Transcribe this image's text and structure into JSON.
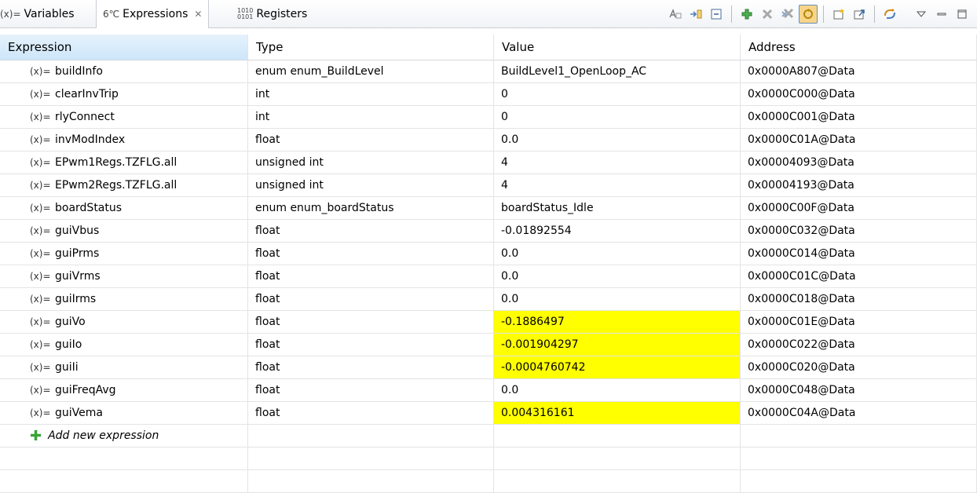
{
  "tabs": [
    {
      "icon": "(x)=",
      "label": "Variables"
    },
    {
      "icon": "6℃",
      "label": "Expressions",
      "close": "✕"
    },
    {
      "icon": "1010\n0101",
      "label": "Registers"
    }
  ],
  "columns": [
    "Expression",
    "Type",
    "Value",
    "Address"
  ],
  "rows": [
    {
      "expr": "buildInfo",
      "type": "enum enum_BuildLevel",
      "value": "BuildLevel1_OpenLoop_AC",
      "address": "0x0000A807@Data",
      "changed": false
    },
    {
      "expr": "clearInvTrip",
      "type": "int",
      "value": "0",
      "address": "0x0000C000@Data",
      "changed": false
    },
    {
      "expr": "rlyConnect",
      "type": "int",
      "value": "0",
      "address": "0x0000C001@Data",
      "changed": false
    },
    {
      "expr": "invModIndex",
      "type": "float",
      "value": "0.0",
      "address": "0x0000C01A@Data",
      "changed": false
    },
    {
      "expr": "EPwm1Regs.TZFLG.all",
      "type": "unsigned int",
      "value": "4",
      "address": "0x00004093@Data",
      "changed": false
    },
    {
      "expr": "EPwm2Regs.TZFLG.all",
      "type": "unsigned int",
      "value": "4",
      "address": "0x00004193@Data",
      "changed": false
    },
    {
      "expr": "boardStatus",
      "type": "enum enum_boardStatus",
      "value": "boardStatus_Idle",
      "address": "0x0000C00F@Data",
      "changed": false
    },
    {
      "expr": "guiVbus",
      "type": "float",
      "value": "-0.01892554",
      "address": "0x0000C032@Data",
      "changed": false
    },
    {
      "expr": "guiPrms",
      "type": "float",
      "value": "0.0",
      "address": "0x0000C014@Data",
      "changed": false
    },
    {
      "expr": "guiVrms",
      "type": "float",
      "value": "0.0",
      "address": "0x0000C01C@Data",
      "changed": false
    },
    {
      "expr": "guiIrms",
      "type": "float",
      "value": "0.0",
      "address": "0x0000C018@Data",
      "changed": false
    },
    {
      "expr": "guiVo",
      "type": "float",
      "value": "-0.1886497",
      "address": "0x0000C01E@Data",
      "changed": true
    },
    {
      "expr": "guiIo",
      "type": "float",
      "value": "-0.001904297",
      "address": "0x0000C022@Data",
      "changed": true
    },
    {
      "expr": "guiIi",
      "type": "float",
      "value": "-0.0004760742",
      "address": "0x0000C020@Data",
      "changed": true
    },
    {
      "expr": "guiFreqAvg",
      "type": "float",
      "value": "0.0",
      "address": "0x0000C048@Data",
      "changed": false
    },
    {
      "expr": "guiVema",
      "type": "float",
      "value": "0.004316161",
      "address": "0x0000C04A@Data",
      "changed": true
    }
  ],
  "add_row_label": "Add new expression",
  "variable_icon": "(x)=",
  "highlight_color": "#ffff00"
}
